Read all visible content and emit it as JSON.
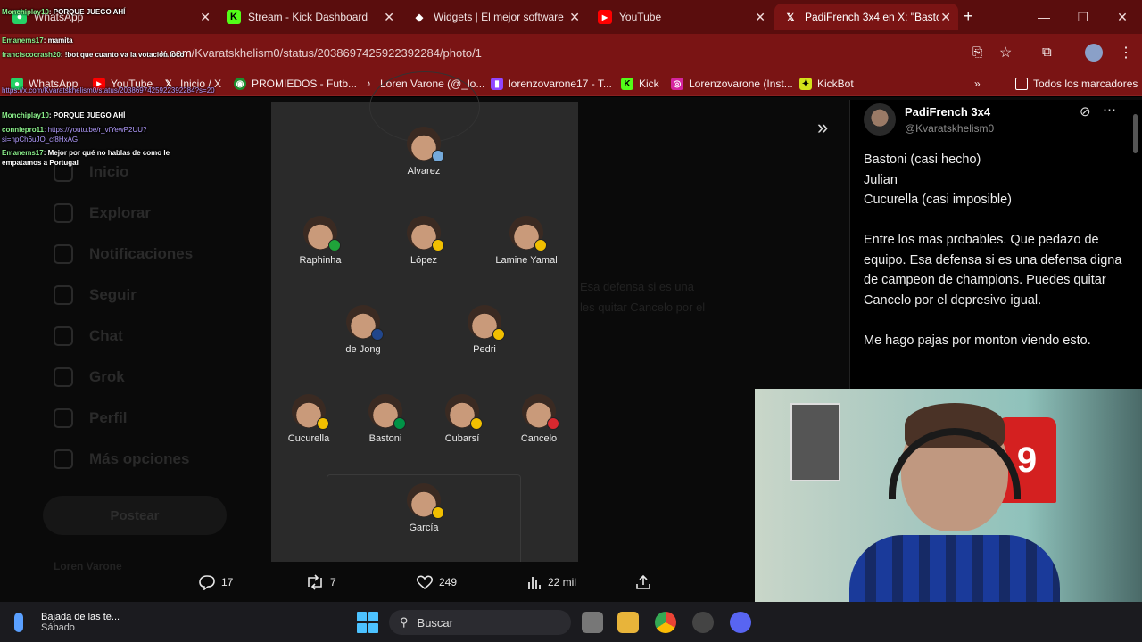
{
  "tabs": [
    {
      "label": "WhatsApp",
      "icon": "whatsapp-icon",
      "active": false
    },
    {
      "label": "Stream - Kick Dashboard",
      "icon": "kick-icon",
      "active": false
    },
    {
      "label": "Widgets | El mejor software",
      "icon": "widget-icon",
      "active": false
    },
    {
      "label": "YouTube",
      "icon": "youtube-icon",
      "active": false
    },
    {
      "label": "PadiFrench 3x4 en X: \"Bastoni",
      "icon": "x-icon",
      "active": true
    }
  ],
  "address": {
    "host": "x.com",
    "path": "/Kvaratskhelism0/status/2038697425922392284/photo/1"
  },
  "bookmarks": [
    {
      "label": "WhatsApp"
    },
    {
      "label": "YouTube"
    },
    {
      "label": "Inicio / X"
    },
    {
      "label": "PROMIEDOS - Futb..."
    },
    {
      "label": "Loren Varone (@_lo..."
    },
    {
      "label": "lorenzovarone17 - T..."
    },
    {
      "label": "Kick"
    },
    {
      "label": "Lorenzovarone (Inst..."
    },
    {
      "label": "KickBot"
    },
    {
      "label": "Todos los marcadores"
    }
  ],
  "leftnav": [
    "Inicio",
    "Explorar",
    "Notificaciones",
    "Seguir",
    "Chat",
    "Grok",
    "Perfil",
    "Más opciones"
  ],
  "post_button": "Postear",
  "footer_user": "Loren Varone",
  "bg_text": [
    "Esa defensa si es una",
    "les quitar Cancelo por el"
  ],
  "lineup": [
    {
      "name": "Alvarez",
      "flag": "#75aadb"
    },
    {
      "name": "Raphinha",
      "flag": "#1fa33a"
    },
    {
      "name": "López",
      "flag": "#f1bf00"
    },
    {
      "name": "Lamine Yamal",
      "flag": "#f1bf00"
    },
    {
      "name": "de Jong",
      "flag": "#21468b"
    },
    {
      "name": "Pedri",
      "flag": "#f1bf00"
    },
    {
      "name": "Cucurella",
      "flag": "#f1bf00"
    },
    {
      "name": "Bastoni",
      "flag": "#009246"
    },
    {
      "name": "Cubarsí",
      "flag": "#f1bf00"
    },
    {
      "name": "Cancelo",
      "flag": "#d8282f"
    },
    {
      "name": "García",
      "flag": "#f1bf00"
    }
  ],
  "actions": {
    "replies": "17",
    "reposts": "7",
    "likes": "249",
    "views": "22 mil"
  },
  "tweet": {
    "author": "PadiFrench 3x4",
    "handle": "@Kvaratskhelism0",
    "paragraphs": [
      [
        "Bastoni (casi hecho)",
        "Julian",
        "Cucurella (casi imposible)"
      ],
      [
        "Entre los mas probables. Que pedazo de equipo. Esa defensa si es una defensa digna de campeon de champions. Puedes quitar Cancelo por el depresivo igual."
      ],
      [
        "Me hago pajas por monton viendo esto."
      ]
    ]
  },
  "chat": [
    {
      "user": "Monchiplay10",
      "msg": ": PORQUE JUEGO AHÍ"
    },
    {
      "user": "Emanems17",
      "msg": ": mamita"
    },
    {
      "user": "franciscocrash20",
      "msg": ": !bot que cuanto va la votacion loco"
    },
    {
      "user": "",
      "msg": "https://x.com/Kvaratskhelism0/status/2038697425922392284?s=20",
      "link": true
    },
    {
      "user": "Monchiplay10",
      "msg": ": PORQUE JUEGO AHÍ"
    },
    {
      "user": "conniepro11",
      "msg": ": https://youtu.be/r_vfYewP2UU?si=hpCh6uJO_cf8HxAG",
      "link": true
    },
    {
      "user": "Emanems17",
      "msg": ": Mejor por qué no hablas de como le empatamos a Portugal"
    }
  ],
  "taskbar": {
    "weather_title": "Bajada de las te...",
    "weather_sub": "Sábado",
    "search": "Buscar"
  },
  "colors": {
    "tabstrip": "#5a0d0d",
    "toolbar": "#7a1414",
    "page_bg": "#0a0a0a",
    "photo_bg": "#2a2a2a"
  }
}
